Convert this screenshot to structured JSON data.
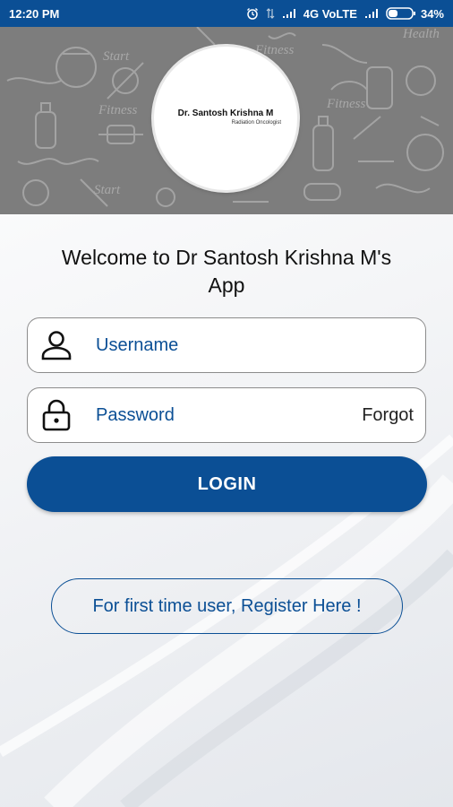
{
  "status_bar": {
    "time": "12:20 PM",
    "network": "4G VoLTE",
    "battery": "34%",
    "icons": [
      "alarm-icon",
      "data-transfer-icon",
      "signal-icon",
      "signal-icon",
      "battery-icon"
    ]
  },
  "header": {
    "logo_title": "Dr. Santosh Krishna M",
    "logo_subtitle": "Radiation Oncologist",
    "background_word": "Fitness",
    "background_word_2": "Start",
    "background_word_3": "Health"
  },
  "welcome": {
    "line1": "Welcome to Dr Santosh Krishna M's",
    "line2": "App"
  },
  "login_form": {
    "username_placeholder": "Username",
    "password_placeholder": "Password",
    "forgot_label": "Forgot",
    "login_label": "LOGIN"
  },
  "register": {
    "label": "For first time user, Register Here !"
  },
  "colors": {
    "primary": "#0b4f95",
    "banner_gray": "#7d7d7d",
    "text": "#111111"
  }
}
